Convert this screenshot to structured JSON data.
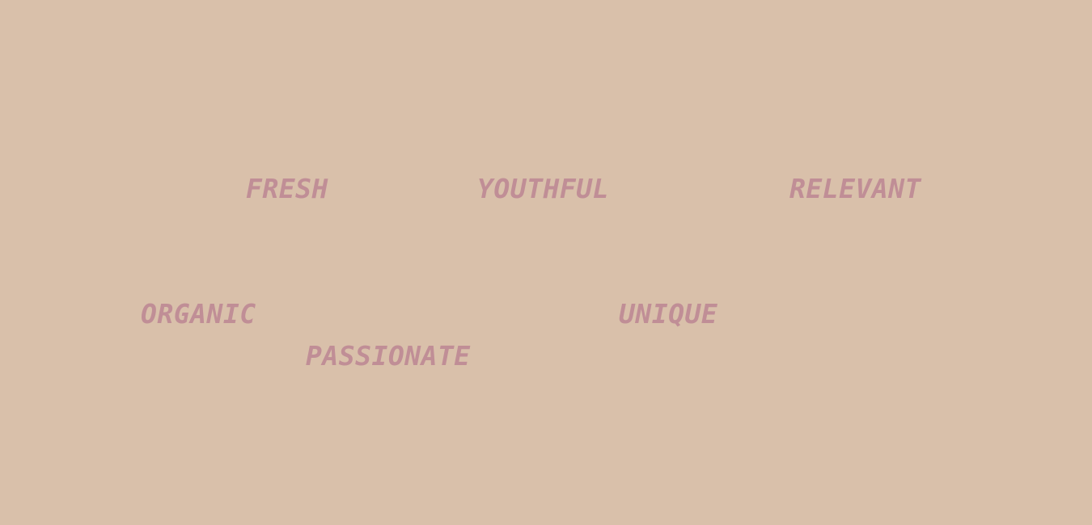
{
  "colors": {
    "background": "#d9c0aa",
    "text": "#c08e96"
  },
  "words": {
    "fresh": "FRESH",
    "youthful": "YOUTHFUL",
    "relevant": "RELEVANT",
    "organic": "ORGANIC",
    "unique": "UNIQUE",
    "passionate": "PASSIONATE"
  }
}
